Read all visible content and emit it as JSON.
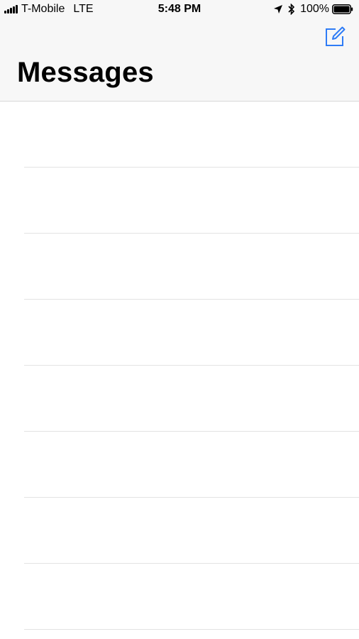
{
  "status_bar": {
    "carrier": "T-Mobile",
    "network": "LTE",
    "time": "5:48 PM",
    "battery_percent": "100%",
    "icons": [
      "signal-bars-icon",
      "location-arrow-icon",
      "bluetooth-icon",
      "battery-icon"
    ]
  },
  "nav": {
    "title": "Messages",
    "compose_icon": "compose-icon",
    "accent_color": "#2f7cf6"
  },
  "conversations": [
    {},
    {},
    {},
    {},
    {},
    {},
    {},
    {}
  ]
}
